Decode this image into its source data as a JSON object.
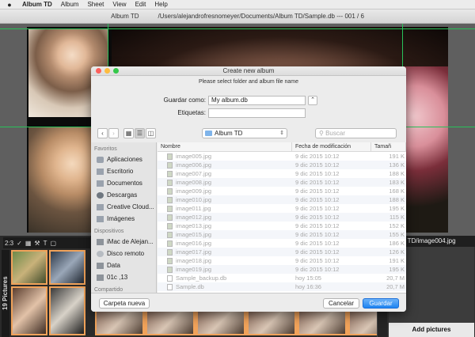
{
  "menubar": {
    "apple": "",
    "app_name": "Album TD",
    "items": [
      "Album",
      "Sheet",
      "View",
      "Edit",
      "Help"
    ]
  },
  "window": {
    "title_left": "Album TD",
    "title_path": "/Users/alejandrofresnomeyer/Documents/Album TD/Sample.db --- 001 / 6"
  },
  "bottom": {
    "toolbar_text": "2:3",
    "pictures_label": "19 Pictures",
    "right_path": "rs/Album TD/image004.jpg",
    "right_vertical": "Pictu",
    "add_pictures": "Add pictures"
  },
  "dialog": {
    "title": "Create new album",
    "instruction": "Please select folder and album file name",
    "save_as_label": "Guardar como:",
    "save_as_value": "My album.db",
    "tags_label": "Etiquetas:",
    "tags_value": "",
    "location": "Album TD",
    "search_placeholder": "Buscar",
    "sidebar": {
      "favorites_head": "Favoritos",
      "favorites": [
        {
          "icon": "applications-icon",
          "label": "Aplicaciones"
        },
        {
          "icon": "desktop-icon",
          "label": "Escritorio"
        },
        {
          "icon": "documents-icon",
          "label": "Documentos"
        },
        {
          "icon": "downloads-icon",
          "label": "Descargas"
        },
        {
          "icon": "cloud-folder-icon",
          "label": "Creative Cloud..."
        },
        {
          "icon": "pictures-icon",
          "label": "Imágenes"
        }
      ],
      "devices_head": "Dispositivos",
      "devices": [
        {
          "icon": "computer-icon",
          "label": "iMac de Alejan..."
        },
        {
          "icon": "disc-icon",
          "label": "Disco remoto"
        },
        {
          "icon": "drive-icon",
          "label": "Data"
        },
        {
          "icon": "drive-icon",
          "label": "01c ,13"
        }
      ],
      "shared_head": "Compartido"
    },
    "columns": {
      "name": "Nombre",
      "modified": "Fecha de modificación",
      "size": "Tamañ"
    },
    "files": [
      {
        "name": "image005.jpg",
        "date": "9 dic 2015 10:12",
        "size": "191 K"
      },
      {
        "name": "image006.jpg",
        "date": "9 dic 2015 10:12",
        "size": "136 K"
      },
      {
        "name": "image007.jpg",
        "date": "9 dic 2015 10:12",
        "size": "188 K"
      },
      {
        "name": "image008.jpg",
        "date": "9 dic 2015 10:12",
        "size": "183 K"
      },
      {
        "name": "image009.jpg",
        "date": "9 dic 2015 10:12",
        "size": "168 K"
      },
      {
        "name": "image010.jpg",
        "date": "9 dic 2015 10:12",
        "size": "188 K"
      },
      {
        "name": "image011.jpg",
        "date": "9 dic 2015 10:12",
        "size": "195 K"
      },
      {
        "name": "image012.jpg",
        "date": "9 dic 2015 10:12",
        "size": "115 K"
      },
      {
        "name": "image013.jpg",
        "date": "9 dic 2015 10:12",
        "size": "152 K"
      },
      {
        "name": "image015.jpg",
        "date": "9 dic 2015 10:12",
        "size": "155 K"
      },
      {
        "name": "image016.jpg",
        "date": "9 dic 2015 10:12",
        "size": "186 K"
      },
      {
        "name": "image017.jpg",
        "date": "9 dic 2015 10:12",
        "size": "126 K"
      },
      {
        "name": "image018.jpg",
        "date": "9 dic 2015 10:12",
        "size": "191 K"
      },
      {
        "name": "image019.jpg",
        "date": "9 dic 2015 10:12",
        "size": "195 K"
      },
      {
        "name": "Sample_backup.db",
        "date": "hoy 15:05",
        "size": "20,7 M"
      },
      {
        "name": "Sample.db",
        "date": "hoy 16:36",
        "size": "20,7 M"
      }
    ],
    "new_folder": "Carpeta nueva",
    "cancel": "Cancelar",
    "save": "Guardar"
  }
}
